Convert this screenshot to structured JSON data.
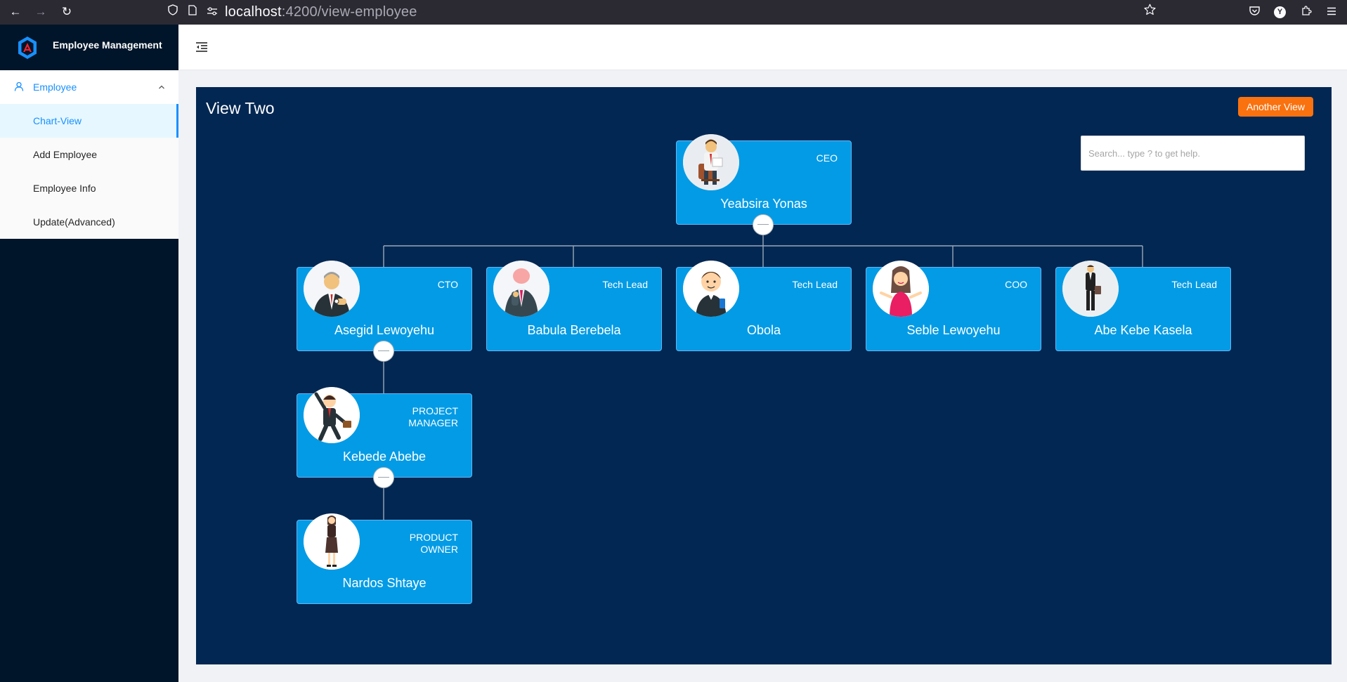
{
  "browser": {
    "url_host": "localhost",
    "url_path": ":4200/view-employee",
    "profile_initial": "Y"
  },
  "sidebar": {
    "brand_title": "Employee Management",
    "group_label": "Employee",
    "items": [
      {
        "label": "Chart-View",
        "active": true
      },
      {
        "label": "Add Employee",
        "active": false
      },
      {
        "label": "Employee Info",
        "active": false
      },
      {
        "label": "Update(Advanced)",
        "active": false
      }
    ]
  },
  "panel": {
    "title": "View Two",
    "another_view_label": "Another View",
    "search_placeholder": "Search... type ? to get help."
  },
  "org": {
    "ceo": {
      "name": "Yeabsira Yonas",
      "role": "CEO",
      "avatar": "man-reading-at-desk-avatar"
    },
    "level2": [
      {
        "name": "Asegid Lewoyehu",
        "role": "CTO",
        "avatar": "businessman-checking-watch-avatar"
      },
      {
        "name": "Babula Berebela",
        "role": "Tech Lead",
        "avatar": "businessman-suit-avatar"
      },
      {
        "name": "Obola",
        "role": "Tech Lead",
        "avatar": "young-man-with-phone-avatar"
      },
      {
        "name": "Seble Lewoyehu",
        "role": "COO",
        "avatar": "woman-shrugging-avatar"
      },
      {
        "name": "Abe Kebe Kasela",
        "role": "Tech Lead",
        "avatar": "man-with-briefcase-avatar"
      }
    ],
    "level3": {
      "name": "Kebede Abebe",
      "role": "PROJECT MANAGER",
      "avatar": "jumping-businessman-avatar"
    },
    "level4": {
      "name": "Nardos Shtaye",
      "role": "PRODUCT OWNER",
      "avatar": "businesswoman-avatar"
    }
  }
}
